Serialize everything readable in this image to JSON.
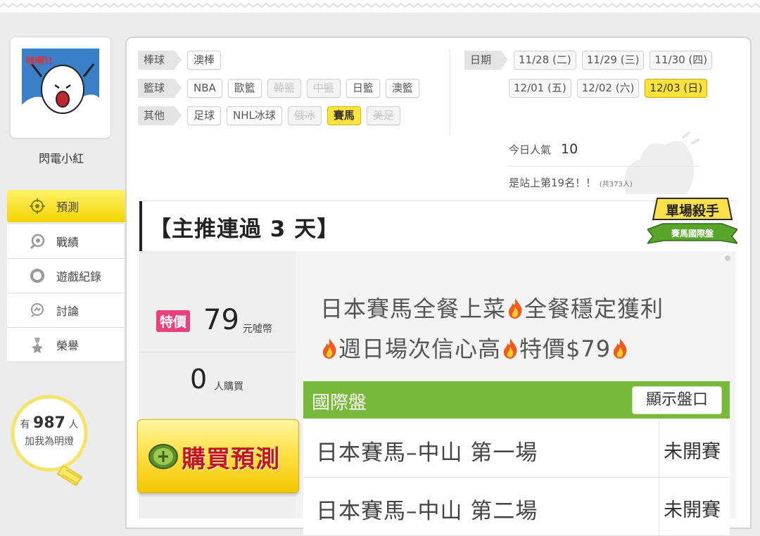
{
  "user": {
    "name": "閃電小紅",
    "avatar_text": "哇啊!!"
  },
  "menu": [
    {
      "label": "預測",
      "icon": "target-icon",
      "active": true
    },
    {
      "label": "戰績",
      "icon": "history-icon",
      "active": false
    },
    {
      "label": "遊戲紀錄",
      "icon": "record-icon",
      "active": false
    },
    {
      "label": "討論",
      "icon": "discuss-icon",
      "active": false
    },
    {
      "label": "榮譽",
      "icon": "medal-icon",
      "active": false
    }
  ],
  "lights": {
    "prefix": "有",
    "count": "987",
    "suffix": "人",
    "caption": "加我為明燈"
  },
  "categories": {
    "baseball": {
      "label": "棒球",
      "items": [
        "澳棒"
      ]
    },
    "basketball": {
      "label": "籃球",
      "items": [
        "NBA",
        "歐籃",
        "韓籃",
        "中籃",
        "日籃",
        "澳籃"
      ]
    },
    "other": {
      "label": "其他",
      "items": [
        "足球",
        "NHL冰球",
        "俄冰",
        "賽馬",
        "美足"
      ]
    }
  },
  "dates": {
    "label": "日期",
    "row1": [
      "11/28 (二)",
      "11/29 (三)",
      "11/30 (四)"
    ],
    "row2": [
      "12/01 (五)",
      "12/02 (六)",
      "12/03 (日)"
    ]
  },
  "popularity": {
    "label": "今日人氣",
    "value": "10",
    "rank_text": "是站上第19名！！",
    "total_text": "(共373人)"
  },
  "title": "【主推連過 3 天】",
  "badge": {
    "line1": "單場殺手",
    "line2": "賽馬國際盤"
  },
  "pricing": {
    "tag": "特價",
    "price": "79",
    "unit": "元噓幣",
    "buyers": "0",
    "buyers_unit": "人購買",
    "buy_label": "購買預測"
  },
  "promo": {
    "line1_a": "日本賽馬全餐上菜",
    "line1_b": "全餐穩定獲利",
    "line2_a": "週日場次信心高",
    "line2_b": "特價$79"
  },
  "table": {
    "header": "國際盤",
    "show_button": "顯示盤口",
    "rows": [
      {
        "name": "日本賽馬–中山 第一場",
        "status": "未開賽"
      },
      {
        "name": "日本賽馬–中山 第二場",
        "status": "未開賽"
      }
    ]
  },
  "colors": {
    "accent_yellow": "#ffe33a",
    "table_green": "#78b83a",
    "special_pink": "#e8417b",
    "buy_red": "#c2161c"
  }
}
